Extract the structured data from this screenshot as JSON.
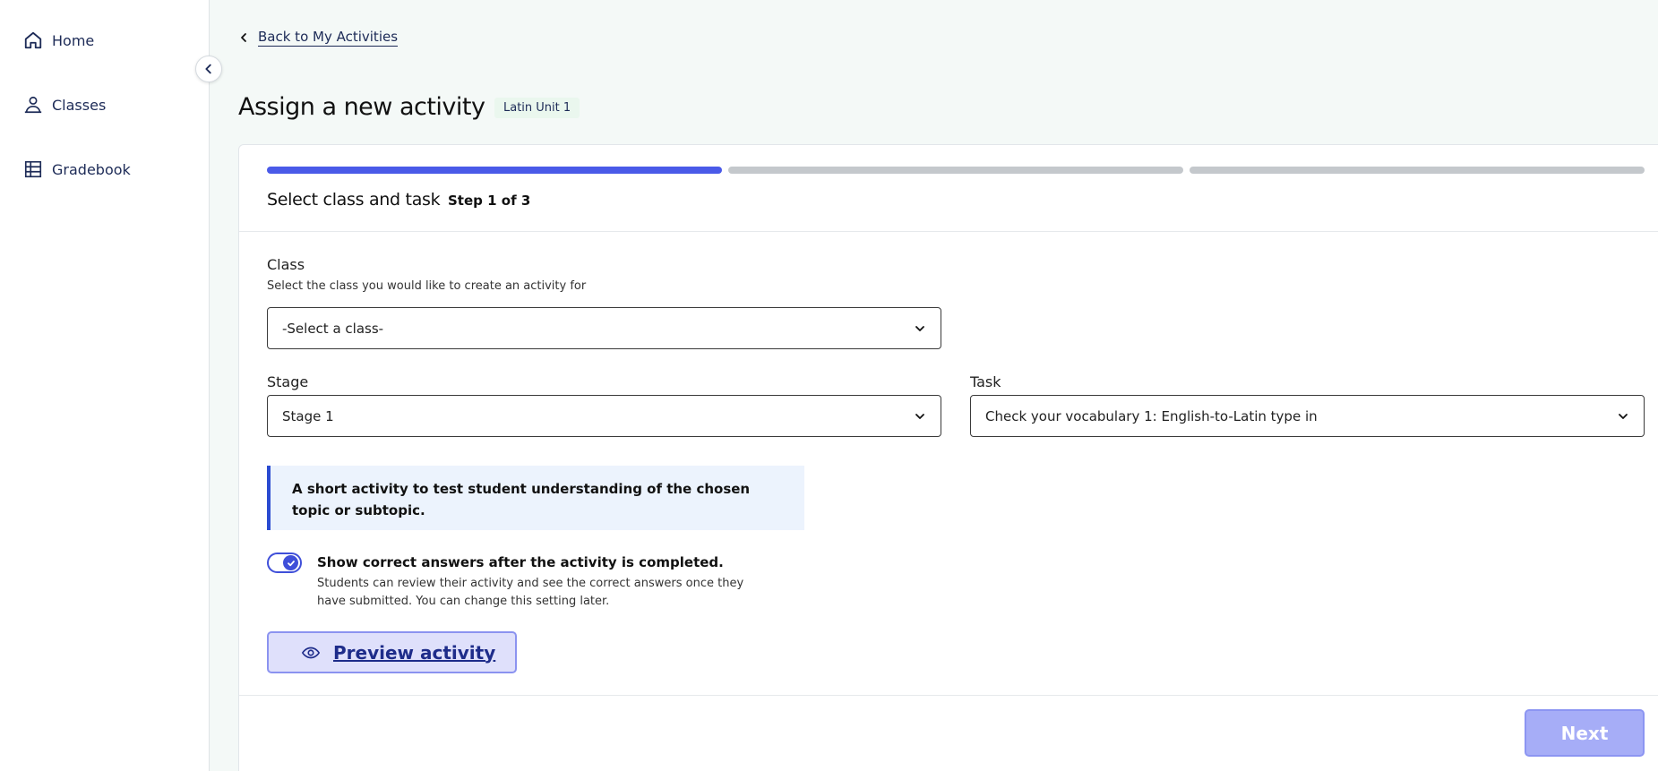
{
  "sidebar": {
    "items": [
      {
        "label": "Home",
        "icon": "home-icon"
      },
      {
        "label": "Classes",
        "icon": "classes-icon"
      },
      {
        "label": "Gradebook",
        "icon": "gradebook-icon"
      }
    ],
    "collapse_icon": "chevron-left-icon"
  },
  "header": {
    "back_label": "Back to My Activities",
    "title": "Assign a new activity",
    "badge": "Latin Unit 1"
  },
  "stepper": {
    "title": "Select class and task",
    "count": "Step 1 of 3",
    "current_step": 1,
    "total_steps": 3
  },
  "form": {
    "class_label": "Class",
    "class_hint": "Select the class you would like to create an activity for",
    "class_value": "-Select a class-",
    "stage_label": "Stage",
    "stage_value": "Stage 1",
    "task_label": "Task",
    "task_value": "Check your vocabulary 1: English-to-Latin type in"
  },
  "info": {
    "text": "A short activity to test student understanding of the chosen topic or subtopic."
  },
  "toggle": {
    "checked": true,
    "title": "Show correct answers after the activity is completed.",
    "description": "Students can review their activity and see the correct answers once they have submitted. You can change this setting later."
  },
  "actions": {
    "preview_label": "Preview activity",
    "next_label": "Next"
  },
  "colors": {
    "accent": "#4a5ae8",
    "nav_text": "#1d2b57",
    "info_border": "#2a4bd1",
    "next_disabled": "#a6adf7"
  }
}
